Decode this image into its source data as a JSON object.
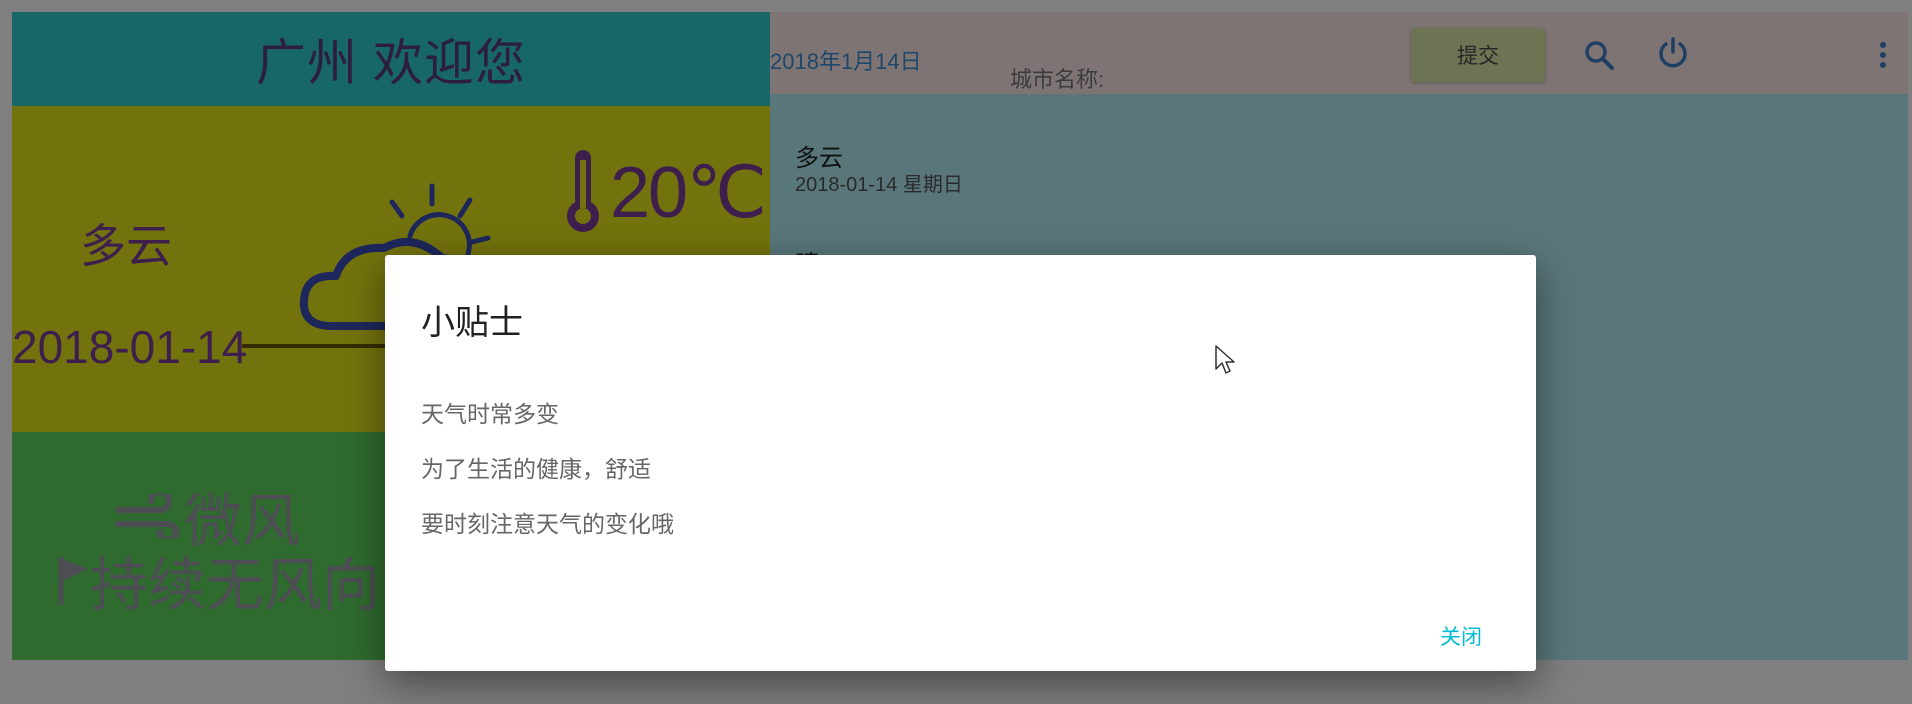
{
  "left": {
    "title": "广州 欢迎您",
    "weather": {
      "description": "多云",
      "date": "2018-01-14",
      "temperature": "20℃",
      "icon": "partly-cloudy-icon"
    },
    "wind": {
      "speed": "微风",
      "direction": "持续无风向"
    }
  },
  "topbar": {
    "date": "2018年1月14日",
    "city_label": "城市名称:",
    "submit_label": "提交"
  },
  "content": {
    "condition1": "多云",
    "date1": "2018-01-14 星期日",
    "condition2": "晴"
  },
  "dialog": {
    "title": "小贴士",
    "lines": [
      "天气时常多变",
      "为了生活的健康，舒适",
      "要时刻注意天气的变化哦"
    ],
    "close_label": "关闭"
  },
  "colors": {
    "title_bg": "#2ecfd1",
    "weather_bg": "#e6e61a",
    "wind_bg": "#5ed65e",
    "content_bg": "#b3eef6",
    "accent": "#00bcd4",
    "text_purple": "#7a3d9a"
  }
}
